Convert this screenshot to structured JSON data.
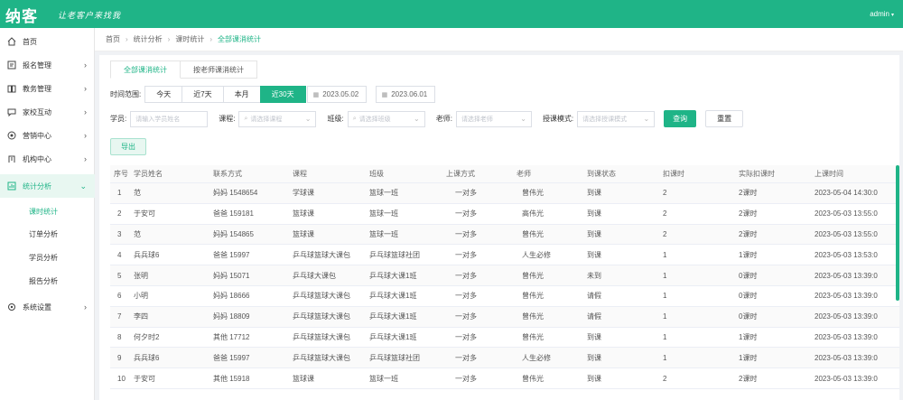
{
  "header": {
    "logo": "纳客",
    "slogan": "让老客户来找我",
    "user": "admin",
    "colors": {
      "brand": "#1fb487",
      "active_bg": "#e8f7f1"
    }
  },
  "sidebar": {
    "items": [
      {
        "label": "首页",
        "icon": "home-icon",
        "arrow": ""
      },
      {
        "label": "报名管理",
        "icon": "registration-icon",
        "arrow": "›"
      },
      {
        "label": "教务管理",
        "icon": "book-icon",
        "arrow": "›"
      },
      {
        "label": "家校互动",
        "icon": "chat-icon",
        "arrow": "›"
      },
      {
        "label": "营销中心",
        "icon": "target-icon",
        "arrow": "›"
      },
      {
        "label": "机构中心",
        "icon": "building-icon",
        "arrow": "›"
      },
      {
        "label": "统计分析",
        "icon": "stats-icon",
        "arrow": "⌄"
      },
      {
        "label": "系统设置",
        "icon": "settings-icon",
        "arrow": "›"
      }
    ],
    "subitems": [
      "课时统计",
      "订单分析",
      "学员分析",
      "报告分析"
    ]
  },
  "breadcrumb": [
    "首页",
    "统计分析",
    "课时统计",
    "全部课消统计"
  ],
  "tabs": [
    "全部课消统计",
    "按老师课消统计"
  ],
  "filters": {
    "time_label": "时间范围:",
    "ranges": [
      "今天",
      "近7天",
      "本月",
      "近30天"
    ],
    "active_range": "近30天",
    "date_start": "2023.05.02",
    "date_end": "2023.06.01",
    "student_label": "学员:",
    "student_placeholder": "请输入学员姓名",
    "course_label": "课程:",
    "course_placeholder": "请选择课程",
    "class_label": "班级:",
    "class_placeholder": "请选择班级",
    "teacher_label": "老师:",
    "teacher_placeholder": "请选择老师",
    "mode_label": "授课模式:",
    "mode_placeholder": "请选择授课模式",
    "query": "查询",
    "reset": "重置",
    "export": "导出"
  },
  "table": {
    "columns": [
      "序号",
      "学员姓名",
      "联系方式",
      "课程",
      "班级",
      "上课方式",
      "老师",
      "到课状态",
      "扣课时",
      "实际扣课时",
      "上课时间"
    ],
    "rows": [
      [
        "1",
        "范",
        "妈妈 1548654",
        "学球课",
        "篮球一班",
        "一对多",
        "曾伟光",
        "到课",
        "2",
        "2课时",
        "2023-05-04 14:30:0"
      ],
      [
        "2",
        "于安可",
        "爸爸 159181",
        "篮球课",
        "篮球一班",
        "一对多",
        "高伟光",
        "到课",
        "2",
        "2课时",
        "2023-05-03 13:55:0"
      ],
      [
        "3",
        "范",
        "妈妈 154865",
        "篮球课",
        "篮球一班",
        "一对多",
        "曾伟光",
        "到课",
        "2",
        "2课时",
        "2023-05-03 13:55:0"
      ],
      [
        "4",
        "兵兵球6",
        "爸爸 15997",
        "乒乓球篮球大课包",
        "乒乓球篮球社团",
        "一对多",
        "人生必修",
        "到课",
        "1",
        "1课时",
        "2023-05-03 13:53:0"
      ],
      [
        "5",
        "张明",
        "妈妈 15071",
        "乒乓球大课包",
        "乒乓球大课1班",
        "一对多",
        "曾伟光",
        "未到",
        "1",
        "0课时",
        "2023-05-03 13:39:0"
      ],
      [
        "6",
        "小明",
        "妈妈 18666",
        "乒乓球篮球大课包",
        "乒乓球大课1班",
        "一对多",
        "曾伟光",
        "请假",
        "1",
        "0课时",
        "2023-05-03 13:39:0"
      ],
      [
        "7",
        "李四",
        "妈妈 18809",
        "乒乓球篮球大课包",
        "乒乓球大课1班",
        "一对多",
        "曾伟光",
        "请假",
        "1",
        "0课时",
        "2023-05-03 13:39:0"
      ],
      [
        "8",
        "何夕时2",
        "其他 17712",
        "乒乓球篮球大课包",
        "乒乓球大课1班",
        "一对多",
        "曾伟光",
        "到课",
        "1",
        "1课时",
        "2023-05-03 13:39:0"
      ],
      [
        "9",
        "兵兵球6",
        "爸爸 15997",
        "乒乓球篮球大课包",
        "乒乓球篮球社团",
        "一对多",
        "人生必修",
        "到课",
        "1",
        "1课时",
        "2023-05-03 13:39:0"
      ],
      [
        "10",
        "于安可",
        "其他 15918",
        "篮球课",
        "篮球一班",
        "一对多",
        "曾伟光",
        "到课",
        "2",
        "2课时",
        "2023-05-03 13:39:0"
      ]
    ]
  }
}
